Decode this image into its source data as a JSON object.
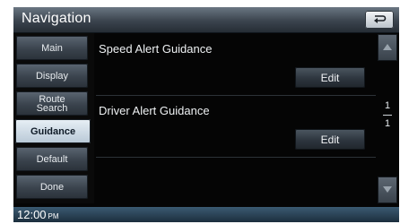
{
  "header": {
    "title": "Navigation",
    "back_icon": "return-arrow-icon"
  },
  "menu": {
    "items": [
      {
        "label": "Main"
      },
      {
        "label": "Display"
      },
      {
        "line1": "Route",
        "line2": "Search"
      },
      {
        "label": "Guidance"
      },
      {
        "label": "Default"
      },
      {
        "label": "Done"
      }
    ],
    "active": "Guidance"
  },
  "content": {
    "rows": [
      {
        "label": "Speed Alert Guidance",
        "button": "Edit"
      },
      {
        "label": "Driver Alert Guidance",
        "button": "Edit"
      }
    ]
  },
  "pager": {
    "current": "1",
    "total": "1",
    "up_icon": "arrow-up-icon",
    "down_icon": "arrow-down-icon"
  },
  "status": {
    "time": "12:00",
    "ampm": "PM"
  },
  "colors": {
    "active_tab": "#cdd9e4",
    "title_bar": "#3b444e",
    "status_bar": "#1c2e3d"
  }
}
